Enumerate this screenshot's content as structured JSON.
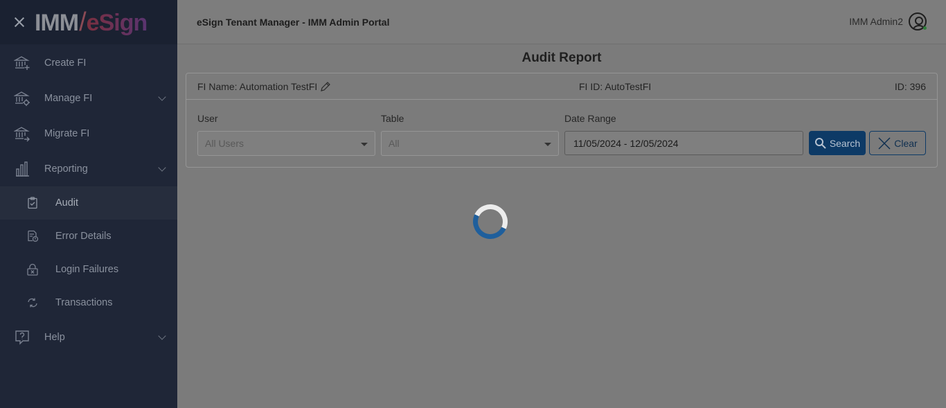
{
  "sidebar": {
    "items": [
      {
        "label": "Create FI",
        "icon": "bank-plus-icon"
      },
      {
        "label": "Manage FI",
        "icon": "bank-gear-icon"
      },
      {
        "label": "Migrate FI",
        "icon": "bank-arrow-icon"
      },
      {
        "label": "Reporting",
        "icon": "bar-chart-icon"
      },
      {
        "label": "Help",
        "icon": "help-bubble-icon"
      }
    ],
    "subitems": [
      {
        "label": "Audit",
        "icon": "clipboard-check-icon"
      },
      {
        "label": "Error Details",
        "icon": "document-error-icon"
      },
      {
        "label": "Login Failures",
        "icon": "lock-x-icon"
      },
      {
        "label": "Transactions",
        "icon": "sync-icon"
      }
    ]
  },
  "logo": {
    "part1": "IMM",
    "part2": "eSign"
  },
  "header": {
    "app_title": "eSign Tenant Manager - IMM Admin Portal",
    "user_name": "IMM Admin2"
  },
  "page": {
    "title": "Audit Report"
  },
  "fi": {
    "name": "FI Name: Automation TestFI",
    "id": "FI ID: AutoTestFI",
    "num": "ID: 396"
  },
  "filters": {
    "user_label": "User",
    "user_value": "All Users",
    "table_label": "Table",
    "table_value": "All",
    "date_label": "Date Range",
    "date_value": "11/05/2024 - 12/05/2024",
    "search_label": "Search",
    "clear_label": "Clear"
  },
  "colors": {
    "sidebar_bg": "#1f2637",
    "primary": "#0d3a66",
    "spinner": "#1f5f9c"
  }
}
